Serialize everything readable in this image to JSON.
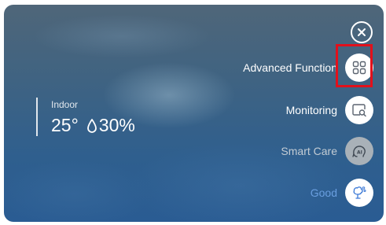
{
  "indoor": {
    "label": "Indoor",
    "temperature": "25°",
    "humidity": "30%"
  },
  "menu": {
    "items": [
      {
        "label": "Advanced Function",
        "icon": "grid-icon"
      },
      {
        "label": "Monitoring",
        "icon": "monitor-search-icon"
      },
      {
        "label": "Smart Care",
        "icon": "ai-care-icon"
      },
      {
        "label": "Good",
        "icon": "tree-air-icon"
      }
    ]
  },
  "colors": {
    "label_white": "#ffffff",
    "label_muted": "#c3ccd4",
    "label_good": "#6a9fe0",
    "highlight": "#e2101b",
    "icon_dark": "#5b6470",
    "icon_blue": "#3a78d6"
  }
}
